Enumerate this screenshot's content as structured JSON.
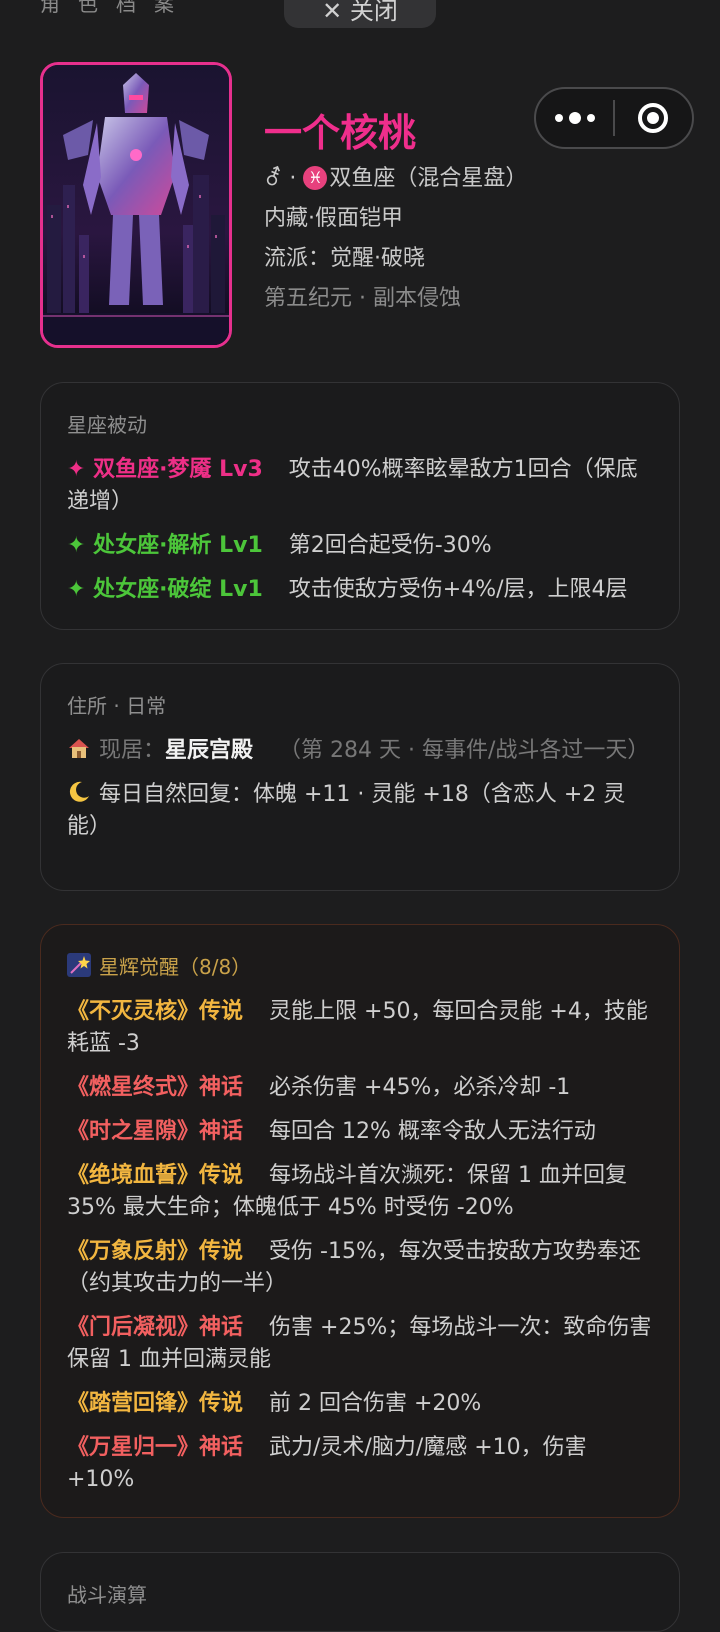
{
  "top": {
    "title": "角色档案",
    "close_label": "✕ 关闭"
  },
  "profile": {
    "name": "一个核桃",
    "gender_symbol": "⚦",
    "separator": " · ",
    "pisces_symbol": "♓",
    "sign": "双鱼座（混合星盘）",
    "hidden": "内藏·假面铠甲",
    "school": "流派：觉醒·破晓",
    "era": "第五纪元 · 副本侵蚀"
  },
  "constellation": {
    "title": "星座被动",
    "items": [
      {
        "name": "✦ 双鱼座·梦魇 Lv3",
        "desc": "攻击40%概率眩晕敌方1回合（保底递增）",
        "color": "#ee2f87"
      },
      {
        "name": "✦ 处女座·解析 Lv1",
        "desc": "第2回合起受伤-30%",
        "color": "#4cc63a"
      },
      {
        "name": "✦ 处女座·破绽 Lv1",
        "desc": "攻击使敌方受伤+4%/层，上限4层",
        "color": "#4cc63a"
      }
    ]
  },
  "residence": {
    "title": "住所 · 日常",
    "home_label": "现居：",
    "home_name": "星辰宫殿",
    "home_note": "（第 284 天 · 每事件/战斗各过一天）",
    "daily": "每日自然回复：体魄 +11 · 灵能 +18（含恋人 +2 灵能）"
  },
  "awakening": {
    "title": "星辉觉醒（8/8）",
    "items": [
      {
        "name": "《不灭灵核》传说",
        "desc": "灵能上限 +50，每回合灵能 +4，技能耗蓝 -3",
        "rarity": "legend"
      },
      {
        "name": "《燃星终式》神话",
        "desc": "必杀伤害 +45%，必杀冷却 -1",
        "rarity": "myth"
      },
      {
        "name": "《时之星隙》神话",
        "desc": "每回合 12% 概率令敌人无法行动",
        "rarity": "myth"
      },
      {
        "name": "《绝境血誓》传说",
        "desc": "每场战斗首次濒死：保留 1 血并回复 35% 最大生命；体魄低于 45% 时受伤 -20%",
        "rarity": "legend"
      },
      {
        "name": "《万象反射》传说",
        "desc": "受伤 -15%，每次受击按敌方攻势奉还（约其攻击力的一半）",
        "rarity": "legend"
      },
      {
        "name": "《门后凝视》神话",
        "desc": "伤害 +25%；每场战斗一次：致命伤害保留 1 血并回满灵能",
        "rarity": "myth"
      },
      {
        "name": "《踏营回锋》传说",
        "desc": "前 2 回合伤害 +20%",
        "rarity": "legend"
      },
      {
        "name": "《万星归一》神话",
        "desc": "武力/灵术/脑力/魔感 +10，伤害 +10%",
        "rarity": "myth"
      }
    ]
  },
  "battle": {
    "title": "战斗演算"
  },
  "colors": {
    "accent_pink": "#ee2f87",
    "passive_green": "#4cc63a",
    "legend_gold": "#f2b640",
    "myth_red": "#f26060",
    "background": "#1d1d1e"
  }
}
